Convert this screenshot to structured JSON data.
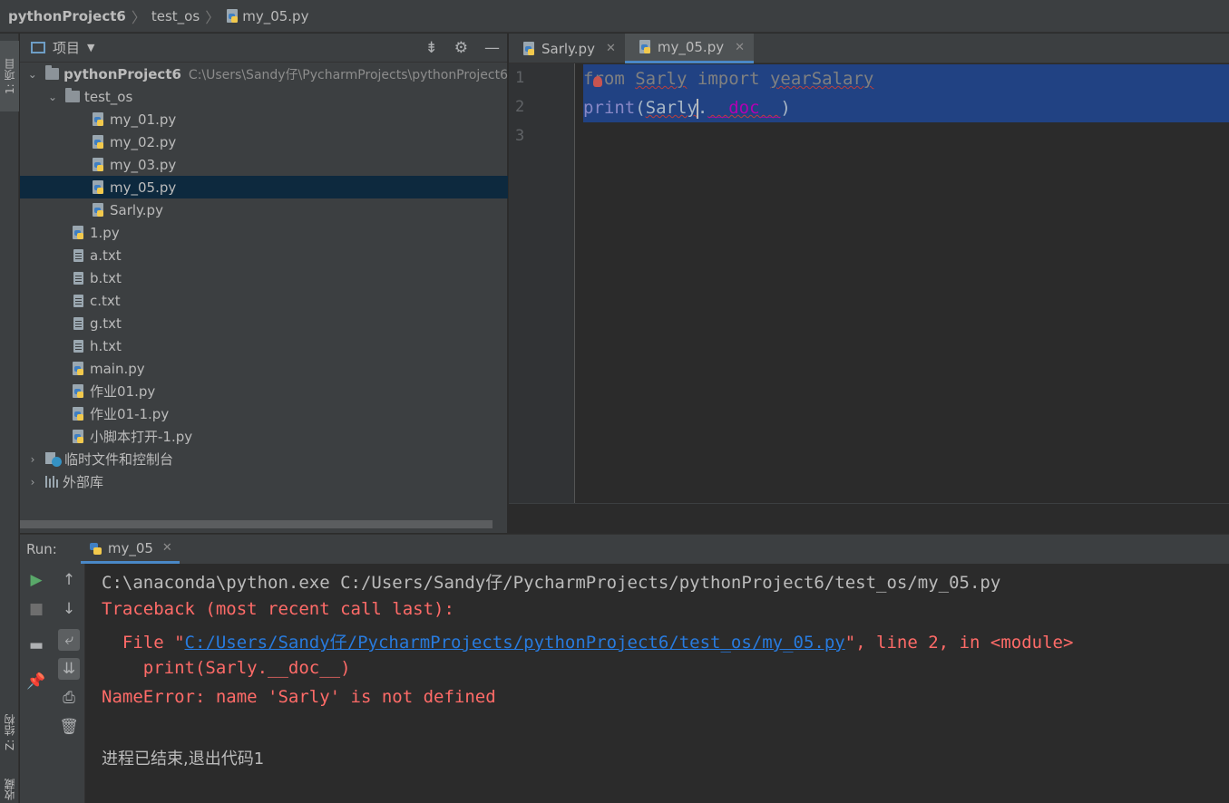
{
  "navbar": {
    "project": "pythonProject6",
    "folder": "test_os",
    "file": "my_05.py"
  },
  "left_stripe": {
    "project_tab": "1: 项目",
    "structure_tab": "Z: 结构",
    "favorites_tab": "收藏"
  },
  "project_panel": {
    "title": "项目",
    "root": {
      "name": "pythonProject6",
      "path": "C:\\Users\\Sandy仔\\PycharmProjects\\pythonProject6"
    },
    "folder": "test_os",
    "folder_files": [
      "my_01.py",
      "my_02.py",
      "my_03.py",
      "my_05.py",
      "Sarly.py"
    ],
    "selected": "my_05.py",
    "root_files": [
      {
        "name": "1.py",
        "type": "py"
      },
      {
        "name": "a.txt",
        "type": "txt"
      },
      {
        "name": "b.txt",
        "type": "txt"
      },
      {
        "name": "c.txt",
        "type": "txt"
      },
      {
        "name": "g.txt",
        "type": "txt"
      },
      {
        "name": "h.txt",
        "type": "txt"
      },
      {
        "name": "main.py",
        "type": "py"
      },
      {
        "name": "作业01.py",
        "type": "py"
      },
      {
        "name": "作业01-1.py",
        "type": "py"
      },
      {
        "name": "小脚本打开-1.py",
        "type": "py"
      }
    ],
    "scratches": "临时文件和控制台",
    "external_libs": "外部库"
  },
  "editor": {
    "tabs": [
      {
        "label": "Sarly.py",
        "active": false
      },
      {
        "label": "my_05.py",
        "active": true
      }
    ],
    "line_numbers": [
      "1",
      "2",
      "3"
    ],
    "line1": {
      "kw": "from",
      "module": "Sarly",
      "kw2": "import",
      "name": "yearSalary"
    },
    "line2": {
      "fn": "print",
      "open": "(",
      "obj": "Sarly",
      "dot": ".",
      "attr": "__doc__",
      "close": ")"
    }
  },
  "run": {
    "label": "Run:",
    "tab": "my_05",
    "console": {
      "cmd": "C:\\anaconda\\python.exe C:/Users/Sandy仔/PycharmProjects/pythonProject6/test_os/my_05.py",
      "traceback": "Traceback (most recent call last):",
      "file_prefix": "  File \"",
      "file_link": "C:/Users/Sandy仔/PycharmProjects/pythonProject6/test_os/my_05.py",
      "file_suffix": "\", line 2, in <module>",
      "code_line": "    print(Sarly.__doc__)",
      "error": "NameError: name 'Sarly' is not defined",
      "exit": "进程已结束,退出代码1"
    }
  },
  "colors": {
    "accent": "#4a88c7",
    "selection": "#214283",
    "error": "#ff6b68",
    "link": "#287bde"
  }
}
